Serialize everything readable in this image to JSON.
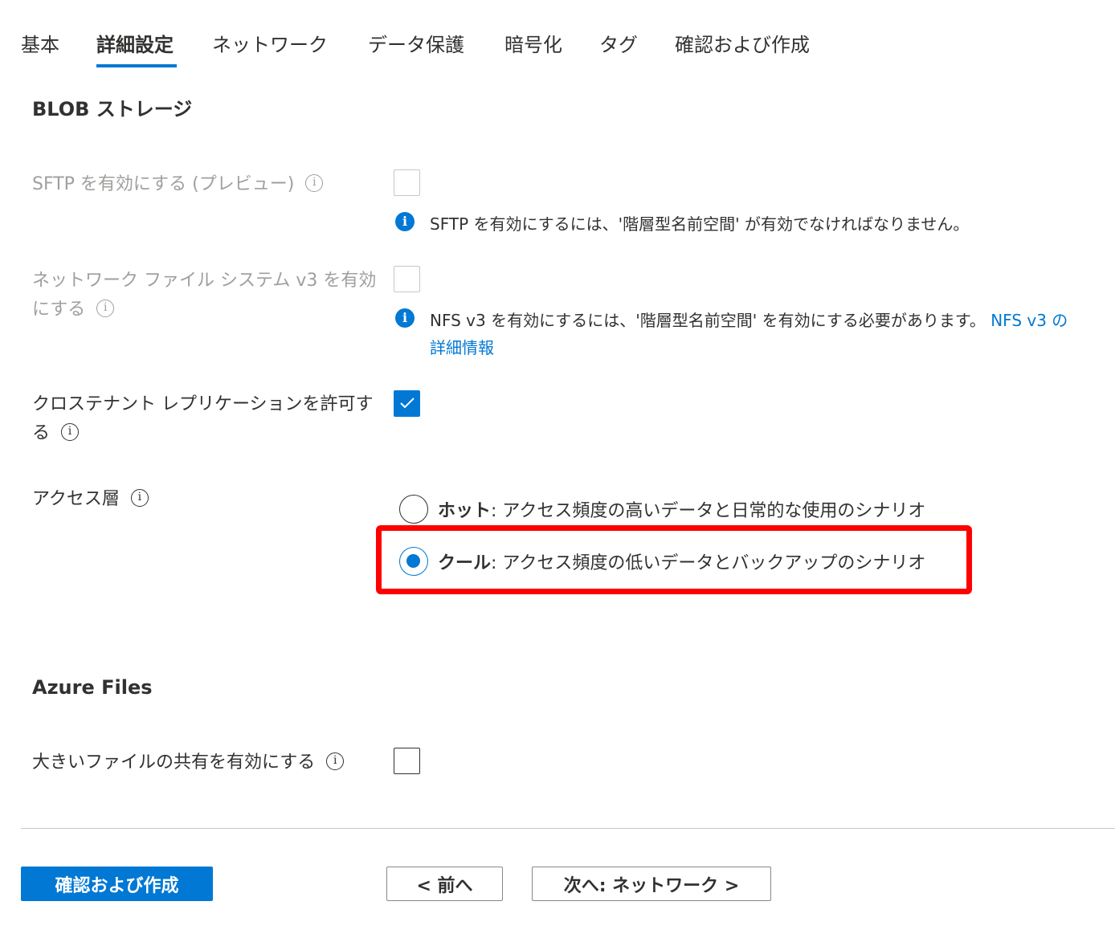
{
  "tabs": [
    {
      "label": "基本"
    },
    {
      "label": "詳細設定"
    },
    {
      "label": "ネットワーク"
    },
    {
      "label": "データ保護"
    },
    {
      "label": "暗号化"
    },
    {
      "label": "タグ"
    },
    {
      "label": "確認および作成"
    }
  ],
  "active_tab": "詳細設定",
  "blob": {
    "title": "BLOB ストレージ",
    "sftp_label": "SFTP を有効にする (プレビュー)",
    "sftp_note": "SFTP を有効にするには、'階層型名前空間' が有効でなければなりません。",
    "nfs_label": "ネットワーク ファイル システム v3 を有効にする",
    "nfs_note": "NFS v3 を有効にするには、'階層型名前空間' を有効にする必要があります。",
    "nfs_link": "NFS v3 の詳細情報",
    "cross_tenant_label": "クロステナント レプリケーションを許可する",
    "cross_tenant_checked": true,
    "access_tier_label": "アクセス層",
    "tiers": [
      {
        "name": "ホット",
        "desc": ": アクセス頻度の高いデータと日常的な使用のシナリオ",
        "selected": false
      },
      {
        "name": "クール",
        "desc": ": アクセス頻度の低いデータとバックアップのシナリオ",
        "selected": true
      }
    ]
  },
  "files": {
    "title": "Azure Files",
    "large_share_label": "大きいファイルの共有を有効にする"
  },
  "info_glyph": "i",
  "footer": {
    "review_create": "確認および作成",
    "prev": "< 前へ",
    "next": "次へ: ネットワーク >"
  },
  "colors": {
    "accent": "#0078d4",
    "highlight": "#ff0000",
    "disabled_text": "#a19f9d"
  }
}
